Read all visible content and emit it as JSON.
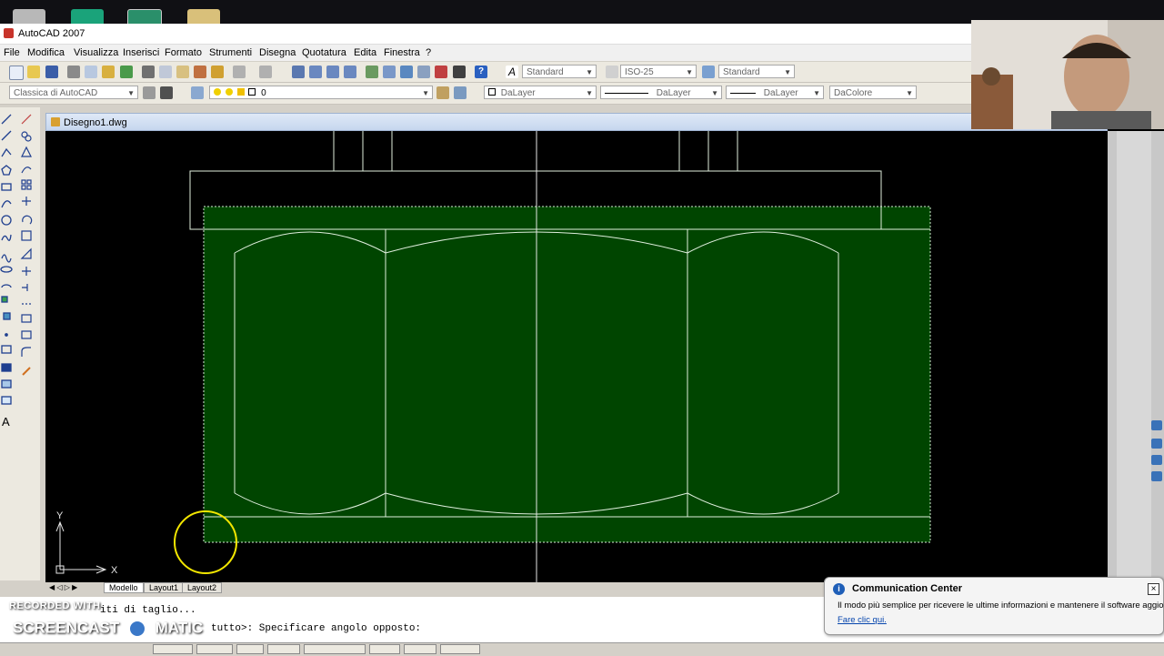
{
  "window": {
    "title": "AutoCAD 2007"
  },
  "menu": [
    "File",
    "Modifica",
    "Visualizza",
    "Inserisci",
    "Formato",
    "Strumenti",
    "Disegna",
    "Quotatura",
    "Edita",
    "Finestra",
    "?"
  ],
  "toolbar1": {
    "text_style": "Standard",
    "dim_style": "ISO-25",
    "table_style": "Standard"
  },
  "toolbar2": {
    "workspace": "Classica di AutoCAD",
    "layer": "0",
    "color": "DaLayer",
    "linetype": "DaLayer",
    "lineweight": "DaLayer",
    "plot_style": "DaColore"
  },
  "document": {
    "tab_name": "Disegno1.dwg"
  },
  "ucs": {
    "x_label": "X",
    "y_label": "Y"
  },
  "layout_tabs": [
    "Modello",
    "Layout1",
    "Layout2"
  ],
  "command": {
    "line1": "iti di taglio...",
    "line2": "tutto>: Specificare angolo opposto:"
  },
  "watermark": {
    "line1": "RECORDED WITH",
    "line2": "SCREENCAST",
    "line2b": "MATIC"
  },
  "notification": {
    "title": "Communication Center",
    "body": "Il modo più semplice per ricevere le ultime informazioni e mantenere il software aggiornato.",
    "link": "Fare clic qui."
  },
  "colors": {
    "selection_fill": "#004500",
    "cursor_ring": "#f2e600",
    "geometry": "#e0f0e0"
  }
}
